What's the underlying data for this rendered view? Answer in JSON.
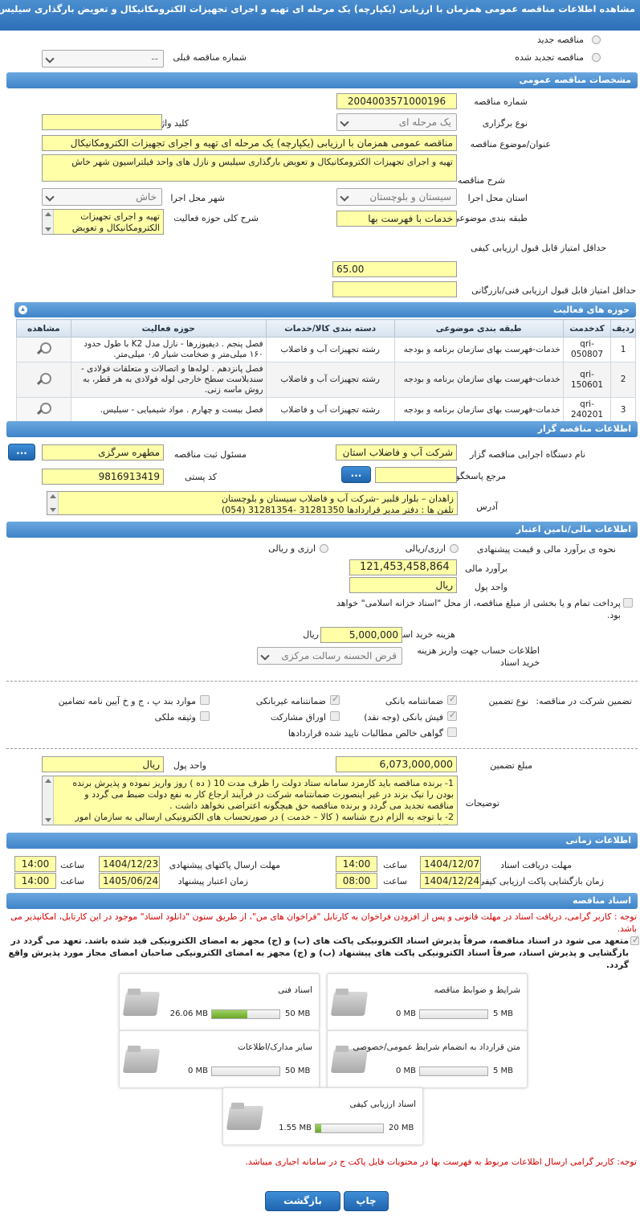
{
  "title": "مشاهده اطلاعات مناقصه عمومی همزمان با ارزیابی (یکپارچه) یک مرحله ای تهیه و اجرای تجهیزات الکترومکانیکال و تعویض بارگذاری سیلیس و نازل های واحد فیلتراسیون شهر خاش",
  "header": {
    "new_tender_label": "مناقصه جدید",
    "renewed_tender_label": "مناقصه تجدید شده",
    "prev_number_label": "شماره مناقصه قبلی",
    "prev_number_value": "--"
  },
  "general": {
    "section_title": "مشخصات مناقصه عمومی",
    "number_label": "شماره مناقصه",
    "number_value": "2004003571000196",
    "type_label": "نوع برگزاری",
    "type_value": "یک مرحله ای",
    "keyword_label": "کلید واژه",
    "keyword_value": "",
    "subject_label": "عنوان/موضوع مناقصه",
    "subject_value": "مناقصه عمومی همزمان با ارزیابی (یکپارچه) یک مرحله ای تهیه و اجرای تجهیزات الکترومکانیکال",
    "desc_label": "شرح مناقصه",
    "desc_value": "تهیه و اجرای تجهیزات الکترومکانیکال و  تعویض بارگذاری سیلیس و نازل های واحد فیلتراسیون شهر خاش",
    "province_label": "استان محل اجرا",
    "province_value": "سیستان و بلوچستان",
    "city_label": "شهر محل اجرا",
    "city_value": "خاش",
    "category_label": "طبقه بندی موضوعی",
    "category_value": "خدمات با فهرست بها",
    "activity_label": "شرح کلی حوزه فعالیت",
    "activity_value": "تهیه و اجرای تجهیزات الکترومکانیکال و  تعویض",
    "min_quality_label": "حداقل امتیاز قابل قبول ارزیابی کیفی",
    "min_quality_value": "65.00",
    "min_tech_label": "حداقل امتیاز قابل قبول ارزیابی فنی/بازرگانی",
    "min_tech_value": ""
  },
  "activities": {
    "section_title": "حوزه های فعالیت",
    "columns": [
      "ردیف",
      "کدخدمت",
      "طبقه بندی موضوعی",
      "دسته بندی کالا/خدمات",
      "حوزه فعالیت",
      "مشاهده"
    ],
    "rows": [
      {
        "n": "1",
        "code": "qri-050807",
        "cat": "خدمات-فهرست بهای سازمان برنامه و بودجه",
        "group": "رشته تجهیزات آب و فاضلاب",
        "field": "فصل پنجم . دیفیوزرها - نازل مدل K2 با طول حدود ۱۶۰ میلی‌متر و ضخامت شیار ۰٫۵ میلی‌متر."
      },
      {
        "n": "2",
        "code": "qri-150601",
        "cat": "خدمات-فهرست بهای سازمان برنامه و بودجه",
        "group": "رشته تجهیزات آب و فاضلاب",
        "field": "فصل پانزدهم . لوله‌ها و اتصالات و متعلقات فولادی - سندبلاست سطح خارجی لوله فولادی به هر قطر، به روش ماسه زنی."
      },
      {
        "n": "3",
        "code": "qri-240201",
        "cat": "خدمات-فهرست بهای سازمان برنامه و بودجه",
        "group": "رشته تجهیزات آب و فاضلاب",
        "field": "فصل بیست و چهارم . مواد شیمیایی - سیلیس."
      }
    ]
  },
  "organizer": {
    "section_title": "اطلاعات مناقصه گزار",
    "org_label": "نام دستگاه اجرایی مناقصه گزار",
    "org_value": "شرکت آب و فاضلاب استان",
    "registrar_label": "مسئول ثبت مناقصه",
    "registrar_value": "مطهره سرگزی",
    "ref_label": "مرجع پاسخگویی",
    "ref_value": "",
    "postal_label": "کد پستی",
    "postal_value": "9816913419",
    "address_label": "آدرس",
    "address_line1": "زاهدان – بلوار قلبیر -شرکت آب و فاضلاب سیستان و بلوچستان",
    "address_line2": "تلفن ها : دفتر مدیر قراردادها    31281350 -31281354 (054)",
    "more_button": "..."
  },
  "finance": {
    "section_title": "اطلاعات مالی/تامین اعتبار",
    "estimate_method_label": "نحوه ی برآورد مالی و قیمت پیشنهادی",
    "opt_rial": "ارزی/ریالی",
    "opt_rial_and_fx": "ارزی و ریالی",
    "estimate_label": "برآورد مالی",
    "estimate_value": "121,453,458,864",
    "currency_label": "واحد پول",
    "currency_value": "ریال",
    "treasury_text": "پرداخت تمام و یا بخشی از مبلغ مناقصه، از محل \"اسناد خزانه اسلامی\" خواهد بود.",
    "doc_fee_label": "هزینه خرید اسناد",
    "doc_fee_value": "5,000,000",
    "doc_fee_unit": "ریال",
    "account_label": "اطلاعات حساب جهت واریز هزینه خرید اسناد",
    "account_value": "قرض الحسنه رسالت مرکزی"
  },
  "guarantee": {
    "participation_label": "تضمین شرکت در مناقصه:",
    "type_label": "نوع تضمین",
    "options": {
      "bank_guarantee": "ضمانتنامه بانکی",
      "nonbank_guarantee": "ضمانتنامه غیربانکی",
      "article_items": "موارد بند پ ، ج و خ آیین نامه تضامین",
      "bank_receipt": "فیش بانکی (وجه نقد)",
      "bonds": "اوراق مشارکت",
      "property": "وثیقه ملکی",
      "claims": "گواهی خالص مطالبات تایید شده قراردادها"
    },
    "amount_label": "مبلغ تضمین",
    "amount_value": "6,073,000,000",
    "currency_label": "واحد پول",
    "currency_value": "ریال",
    "notes_label": "توضیحات",
    "notes_text": "1- برنده مناقصه باید کارمزد سامانه ستاد دولت را ظرف مدت 10 ( ده ) روز واریز نموده و پذیرش برنده بودن را تیک بزند  در غیر اینصورت ضمانتنامه شرکت در فرآیند ارجاع کار به نفع دولت ضبط می گردد و مناقصه تجدید می گردد و برنده مناقصه حق هیچگونه اعتراضی نخواهد داشت .\n2- با توجه به الزام درج شناسه ( کالا – خدمت ) در صورتحساب های الکترونیکی ارسالی به سازمان امور مالیاتی، ..."
  },
  "timing": {
    "section_title": "اطلاعات زمانی",
    "doc_receive_label": "مهلت دریافت اسناد",
    "doc_receive_date": "1404/12/07",
    "doc_receive_time": "14:00",
    "send_deadline_label": "مهلت ارسال پاکتهای پیشنهادی",
    "send_deadline_date": "1404/12/23",
    "send_deadline_time": "14:00",
    "open_label": "زمان بازگشایی پاکت ارزیابی کیفی",
    "open_date": "1404/12/24",
    "open_time": "08:00",
    "validity_label": "زمان اعتبار پیشنهاد",
    "validity_date": "1405/06/24",
    "validity_time": "14:00",
    "time_label": "ساعت"
  },
  "documents": {
    "section_title": "اسناد مناقصه",
    "notice": "توجه : کاربر گرامی، دریافت اسناد در مهلت قانونی و پس از افزودن فراخوان به کارتابل \"فراخوان های من\"، از طریق ستون \"دانلود اسناد\" موجود در این کارتابل، امکانپذیر می باشد.",
    "commitment": "متعهد می شود در اسناد مناقصه، صرفاً پذیرش اسناد الکترونیکی پاکت های (ب) و (ج) مجهز به امضای الکترونیکی قید شده باشد. تعهد می گردد در بازگشایی و پذیرش اسناد، صرفاً اسناد الکترونیکی پاکت های پیشنهاد (ب) و (ج) مجهز به امضای الکترونیکی صاحبان امضای مجاز مورد پذیرش واقع گردد.",
    "files": [
      {
        "name": "شرایط و ضوابط مناقصه",
        "current": "0 MB",
        "max": "5 MB",
        "fill": 0
      },
      {
        "name": "اسناد فنی",
        "current": "26.06 MB",
        "max": "50 MB",
        "fill": 0.52
      },
      {
        "name": "متن قرارداد به انضمام شرایط عمومی/خصوصی",
        "current": "0 MB",
        "max": "5 MB",
        "fill": 0
      },
      {
        "name": "سایر مدارک/اطلاعات",
        "current": "0 MB",
        "max": "50 MB",
        "fill": 0
      },
      {
        "name": "اسناد ارزیابی کیفی",
        "current": "1.55 MB",
        "max": "20 MB",
        "fill": 0.08
      }
    ],
    "footer_notice": "توجه: کاربر گرامی ارسال اطلاعات مربوط به فهرست بها در محتویات فایل پاکت ج در سامانه اجباری میباشد."
  },
  "actions": {
    "print": "چاپ",
    "back": "بازگشت"
  },
  "colors": {
    "accent": "#3f84c9",
    "input_bg": "#ffffa8",
    "notice_red": "#d40000"
  }
}
